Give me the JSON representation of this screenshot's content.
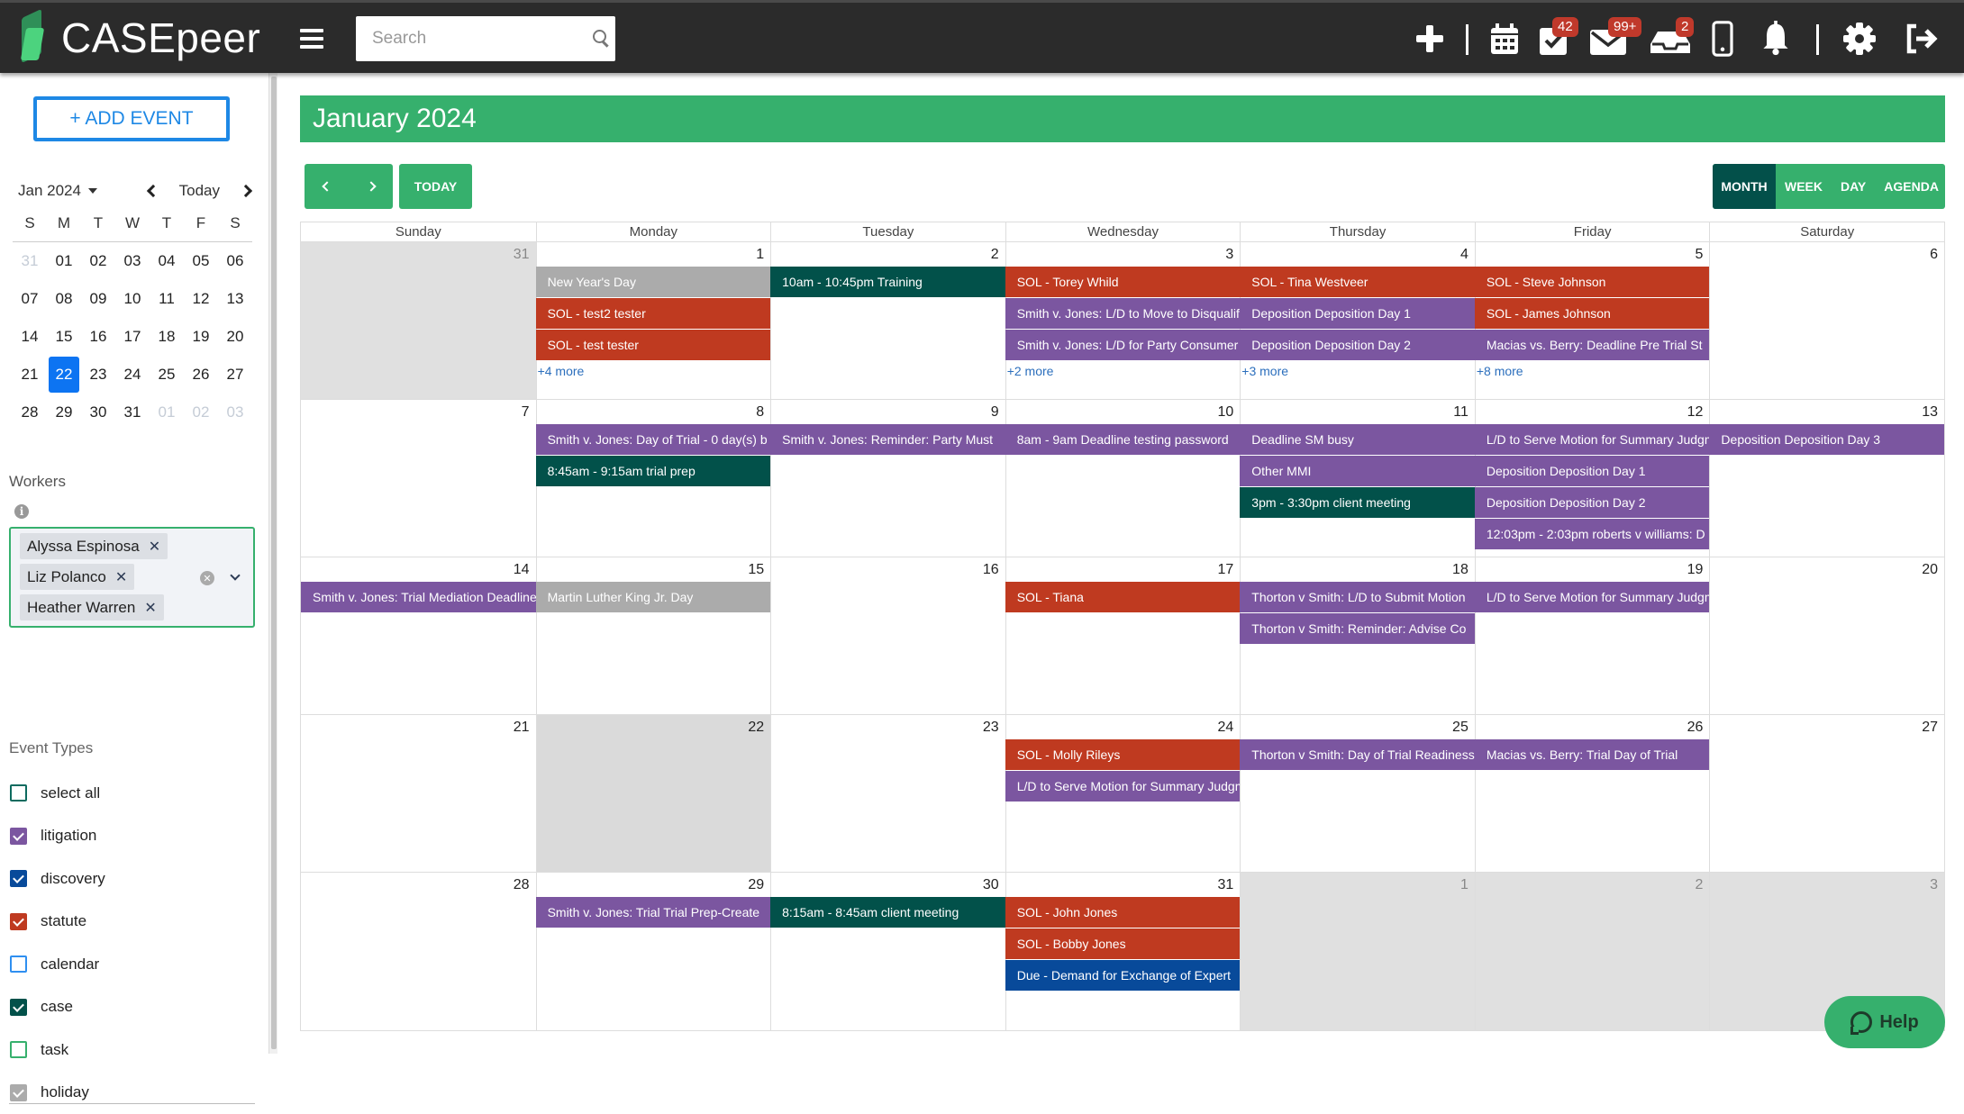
{
  "app": {
    "logo_text": "CASEpeer"
  },
  "topbar": {
    "search_placeholder": "Search",
    "icons": [
      {
        "name": "plus-icon"
      },
      {
        "name": "calendar-icon"
      },
      {
        "name": "tasks-icon",
        "badge": "42"
      },
      {
        "name": "mail-icon",
        "badge": "99+"
      },
      {
        "name": "inbox-icon",
        "badge": "2"
      },
      {
        "name": "mobile-icon"
      },
      {
        "name": "bell-icon"
      },
      {
        "name": "gear-icon"
      },
      {
        "name": "logout-icon"
      }
    ]
  },
  "sidebar": {
    "add_event_label": "+ ADD EVENT",
    "mini_calendar": {
      "month_label": "Jan 2024",
      "today_label": "Today",
      "weekdays": [
        "S",
        "M",
        "T",
        "W",
        "T",
        "F",
        "S"
      ],
      "selected_day": "22",
      "weeks": [
        [
          {
            "d": "31",
            "muted": true
          },
          {
            "d": "01"
          },
          {
            "d": "02"
          },
          {
            "d": "03"
          },
          {
            "d": "04"
          },
          {
            "d": "05"
          },
          {
            "d": "06"
          }
        ],
        [
          {
            "d": "07"
          },
          {
            "d": "08"
          },
          {
            "d": "09"
          },
          {
            "d": "10"
          },
          {
            "d": "11"
          },
          {
            "d": "12"
          },
          {
            "d": "13"
          }
        ],
        [
          {
            "d": "14"
          },
          {
            "d": "15"
          },
          {
            "d": "16"
          },
          {
            "d": "17"
          },
          {
            "d": "18"
          },
          {
            "d": "19"
          },
          {
            "d": "20"
          }
        ],
        [
          {
            "d": "21"
          },
          {
            "d": "22",
            "today": true
          },
          {
            "d": "23"
          },
          {
            "d": "24"
          },
          {
            "d": "25"
          },
          {
            "d": "26"
          },
          {
            "d": "27"
          }
        ],
        [
          {
            "d": "28"
          },
          {
            "d": "29"
          },
          {
            "d": "30"
          },
          {
            "d": "31"
          },
          {
            "d": "01",
            "muted": true
          },
          {
            "d": "02",
            "muted": true
          },
          {
            "d": "03",
            "muted": true
          }
        ]
      ]
    },
    "workers_label": "Workers",
    "workers": [
      "Alyssa Espinosa",
      "Liz Polanco",
      "Heather Warren"
    ],
    "event_types_label": "Event Types",
    "event_types": [
      {
        "label": "select all",
        "checked": false,
        "color": "#0e6b5f"
      },
      {
        "label": "litigation",
        "checked": true,
        "color": "#7b56a0"
      },
      {
        "label": "discovery",
        "checked": true,
        "color": "#084a9a"
      },
      {
        "label": "statute",
        "checked": true,
        "color": "#bf3a20"
      },
      {
        "label": "calendar",
        "checked": false,
        "color": "#2f8ff0"
      },
      {
        "label": "case",
        "checked": true,
        "color": "#02514a"
      },
      {
        "label": "task",
        "checked": false,
        "color": "#36b06d"
      },
      {
        "label": "holiday",
        "checked": true,
        "color": "#ababab"
      }
    ]
  },
  "calendar": {
    "title": "January 2024",
    "today_button": "TODAY",
    "views": [
      "MONTH",
      "WEEK",
      "DAY",
      "AGENDA"
    ],
    "active_view": "MONTH",
    "weekdays": [
      "Sunday",
      "Monday",
      "Tuesday",
      "Wednesday",
      "Thursday",
      "Friday",
      "Saturday"
    ],
    "colors": {
      "statute": "#bf3a20",
      "litigation": "#7b56a0",
      "case": "#02514a",
      "holiday": "#ababab",
      "discovery": "#084a9a",
      "accent": "#36b06d"
    },
    "weeks": [
      [
        {
          "day": "31",
          "off": true,
          "events": []
        },
        {
          "day": "1",
          "events": [
            {
              "title": "New Year's Day",
              "type": "holiday"
            },
            {
              "title": "SOL - test2 tester",
              "type": "statute"
            },
            {
              "title": "SOL - test tester",
              "type": "statute"
            }
          ],
          "more": "+4 more"
        },
        {
          "day": "2",
          "events": [
            {
              "title": "10am - 10:45pm Training",
              "type": "case"
            }
          ]
        },
        {
          "day": "3",
          "events": [
            {
              "title": "SOL - Torey Whild",
              "type": "statute"
            },
            {
              "title": "Smith v. Jones: L/D to Move to Disqualify",
              "type": "litigation"
            },
            {
              "title": "Smith v. Jones: L/D for Party Consumer",
              "type": "litigation"
            }
          ],
          "more": "+2 more"
        },
        {
          "day": "4",
          "events": [
            {
              "title": "SOL - Tina Westveer",
              "type": "statute"
            },
            {
              "title": "Deposition Deposition Day 1",
              "type": "litigation"
            },
            {
              "title": "Deposition Deposition Day 2",
              "type": "litigation"
            }
          ],
          "more": "+3 more"
        },
        {
          "day": "5",
          "events": [
            {
              "title": "SOL - Steve Johnson",
              "type": "statute"
            },
            {
              "title": "SOL - James Johnson",
              "type": "statute"
            },
            {
              "title": "Macias vs. Berry: Deadline Pre Trial St",
              "type": "litigation"
            }
          ],
          "more": "+8 more"
        },
        {
          "day": "6",
          "events": []
        }
      ],
      [
        {
          "day": "7",
          "events": []
        },
        {
          "day": "8",
          "events": [
            {
              "title": "Smith v. Jones: Day of Trial - 0 day(s) b",
              "type": "litigation"
            },
            {
              "title": "8:45am - 9:15am trial prep",
              "type": "case"
            }
          ]
        },
        {
          "day": "9",
          "events": [
            {
              "title": "Smith v. Jones: Reminder: Party Must",
              "type": "litigation"
            }
          ]
        },
        {
          "day": "10",
          "events": [
            {
              "title": "8am - 9am Deadline testing password",
              "type": "litigation"
            }
          ]
        },
        {
          "day": "11",
          "events": [
            {
              "title": "Deadline SM busy",
              "type": "litigation"
            },
            {
              "title": "Other MMI",
              "type": "litigation"
            },
            {
              "title": "3pm - 3:30pm client meeting",
              "type": "case"
            }
          ]
        },
        {
          "day": "12",
          "events": [
            {
              "title": "L/D to Serve Motion for Summary Judgment",
              "type": "litigation"
            },
            {
              "title": "Deposition Deposition Day 1",
              "type": "litigation"
            },
            {
              "title": "Deposition Deposition Day 2",
              "type": "litigation"
            },
            {
              "title": "12:03pm - 2:03pm roberts v williams: D",
              "type": "litigation"
            }
          ]
        },
        {
          "day": "13",
          "events": [
            {
              "title": "Deposition Deposition Day 3",
              "type": "litigation"
            }
          ]
        }
      ],
      [
        {
          "day": "14",
          "events": [
            {
              "title": "Smith v. Jones: Trial Mediation Deadline",
              "type": "litigation"
            }
          ]
        },
        {
          "day": "15",
          "events": [
            {
              "title": "Martin Luther King Jr. Day",
              "type": "holiday"
            }
          ]
        },
        {
          "day": "16",
          "events": []
        },
        {
          "day": "17",
          "events": [
            {
              "title": "SOL - Tiana",
              "type": "statute"
            }
          ]
        },
        {
          "day": "18",
          "events": [
            {
              "title": "Thorton v Smith: L/D to Submit Motion",
              "type": "litigation"
            },
            {
              "title": "Thorton v Smith: Reminder: Advise Co",
              "type": "litigation"
            }
          ]
        },
        {
          "day": "19",
          "events": [
            {
              "title": "L/D to Serve Motion for Summary Judgment",
              "type": "litigation"
            }
          ]
        },
        {
          "day": "20",
          "events": []
        }
      ],
      [
        {
          "day": "21",
          "events": []
        },
        {
          "day": "22",
          "today": true,
          "events": []
        },
        {
          "day": "23",
          "events": []
        },
        {
          "day": "24",
          "events": [
            {
              "title": "SOL - Molly Rileys",
              "type": "statute"
            },
            {
              "title": "L/D to Serve Motion for Summary Judgment",
              "type": "litigation"
            }
          ]
        },
        {
          "day": "25",
          "events": [
            {
              "title": "Thorton v Smith: Day of Trial Readiness",
              "type": "litigation"
            }
          ]
        },
        {
          "day": "26",
          "events": [
            {
              "title": "Macias vs. Berry: Trial Day of Trial",
              "type": "litigation"
            }
          ]
        },
        {
          "day": "27",
          "events": []
        }
      ],
      [
        {
          "day": "28",
          "events": []
        },
        {
          "day": "29",
          "events": [
            {
              "title": "Smith v. Jones: Trial Trial Prep-Create",
              "type": "litigation"
            }
          ]
        },
        {
          "day": "30",
          "events": [
            {
              "title": "8:15am - 8:45am client meeting",
              "type": "case"
            }
          ]
        },
        {
          "day": "31",
          "events": [
            {
              "title": "SOL - John Jones",
              "type": "statute"
            },
            {
              "title": "SOL - Bobby Jones",
              "type": "statute"
            },
            {
              "title": "Due - Demand for Exchange of Expert",
              "type": "discovery"
            }
          ]
        },
        {
          "day": "1",
          "off": true,
          "events": []
        },
        {
          "day": "2",
          "off": true,
          "events": []
        },
        {
          "day": "3",
          "off": true,
          "events": []
        }
      ]
    ]
  },
  "help": {
    "label": "Help"
  }
}
